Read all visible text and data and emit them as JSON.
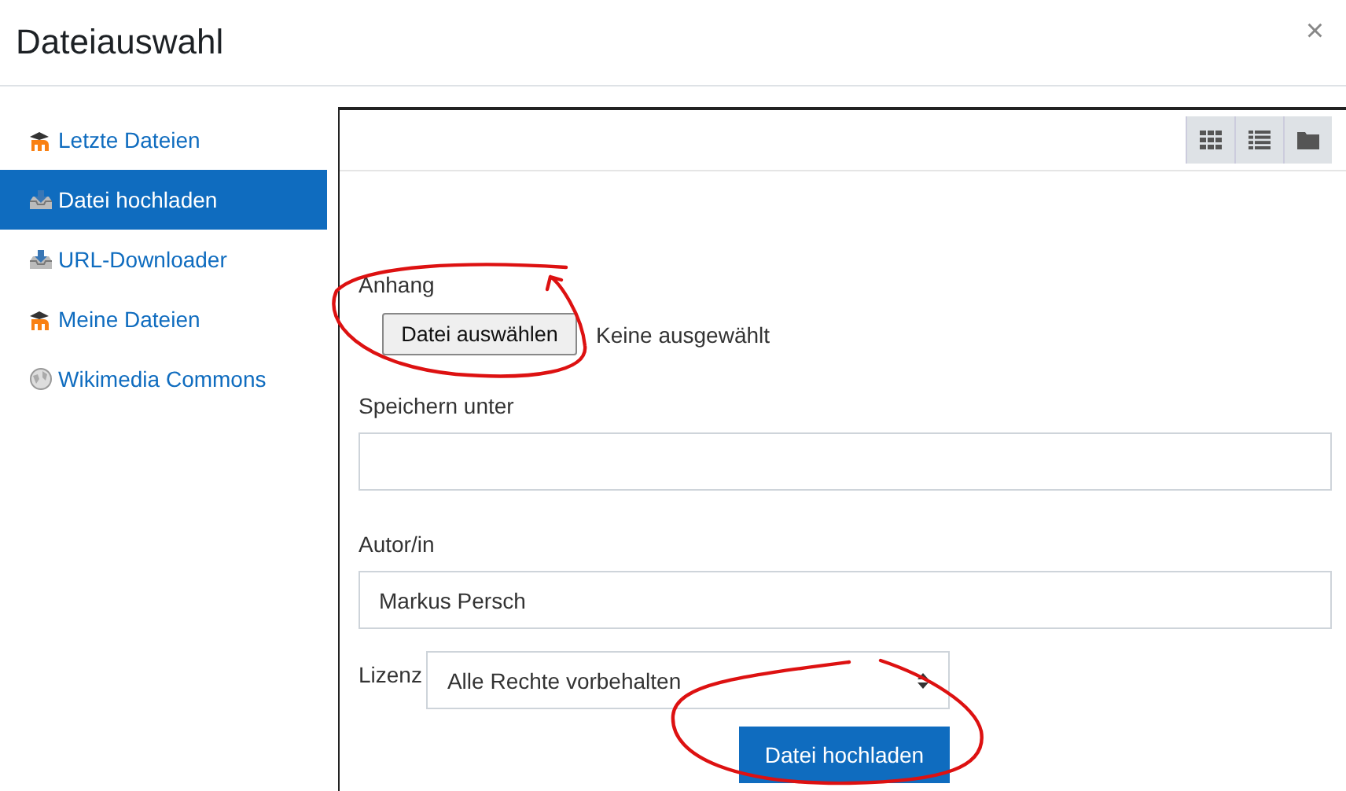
{
  "window": {
    "title": "Dateiauswahl",
    "close": "×"
  },
  "sidebar": {
    "items": [
      {
        "label": "Letzte Dateien",
        "kind": "moodle",
        "selected": false
      },
      {
        "label": "Datei hochladen",
        "kind": "upload",
        "selected": true
      },
      {
        "label": "URL-Downloader",
        "kind": "upload",
        "selected": false
      },
      {
        "label": "Meine Dateien",
        "kind": "moodle",
        "selected": false
      },
      {
        "label": "Wikimedia Commons",
        "kind": "globe",
        "selected": false
      }
    ]
  },
  "toolbar": {
    "views": [
      {
        "kind": "grid"
      },
      {
        "kind": "list"
      },
      {
        "kind": "folder"
      }
    ]
  },
  "form": {
    "attachment": {
      "label": "Anhang",
      "button": "Datei auswählen",
      "status": "Keine ausgewählt"
    },
    "save_as": {
      "label": "Speichern unter"
    },
    "author": {
      "label": "Autor/in",
      "value": "Markus Persch"
    },
    "license": {
      "label": "Lizenz",
      "value": "Alle Rechte vorbehalten"
    },
    "submit": "Datei hochladen"
  }
}
